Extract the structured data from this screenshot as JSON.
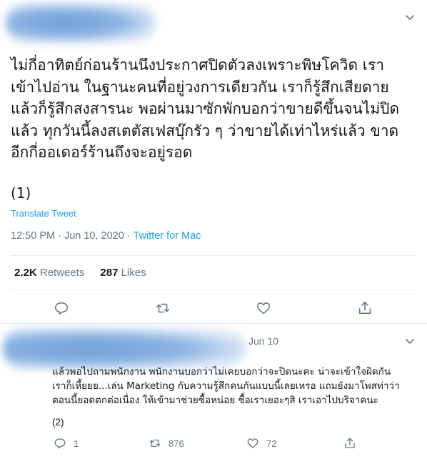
{
  "main_tweet": {
    "text": "ไม่กี่อาทิตย์ก่อนร้านนึงประกาศปิดตัวลงเพราะพิษโควิด เรา\nเข้าไปอ่าน ในฐานะคนที่อยู่วงการเดียวกัน เราก็รู้สึกเสียดาย\nแล้วก็รู้สึกสงสารนะ พอผ่านมาซักพักบอกว่าขายดีขึ้นจนไม่ปิด\nแล้ว ทุกวันนี้ลงสเตตัสเฟสบุ๊กรัว ๆ ว่าขายได้เท่าไหร่แล้ว ขาด\nอีกกี่ออเดอร์ร้านถึงจะอยู่รอด",
    "counter": "(1)",
    "translate_label": "Translate Tweet",
    "timestamp": "12:50 PM · Jun 10, 2020 · ",
    "client": "Twitter for Mac",
    "retweets_count": "2.2K",
    "retweets_label": "Retweets",
    "likes_count": "287",
    "likes_label": "Likes"
  },
  "reply_tweet": {
    "date": "Jun 10",
    "text": "แล้วพอไปถามพนักงาน พนักงานบอกว่าไม่เคยบอกว่าจะปิดนะคะ น่าจะเข้าใจผิดกัน\nเราก็เหี้ยยย...เล่น Marketing กับความรู้สึกคนกันแบบนี้เลยเหรอ แถมยังมาโพสท่าว่า\nตอนนี้ยอดตกต่อเนื่อง ให้เข้ามาช่วยซื้อหน่อย ซื้อเราเยอะๆสิ เราเอาไปบริจาคนะ",
    "counter": "(2)",
    "reply_count": "1",
    "retweet_count": "876",
    "like_count": "72"
  },
  "icons": [
    "chevron-down-icon",
    "reply-icon",
    "retweet-icon",
    "like-icon",
    "share-icon"
  ],
  "colors": {
    "accent": "#1da1f2",
    "muted": "#657786",
    "text": "#14171a",
    "divider": "#e6ecf0"
  }
}
